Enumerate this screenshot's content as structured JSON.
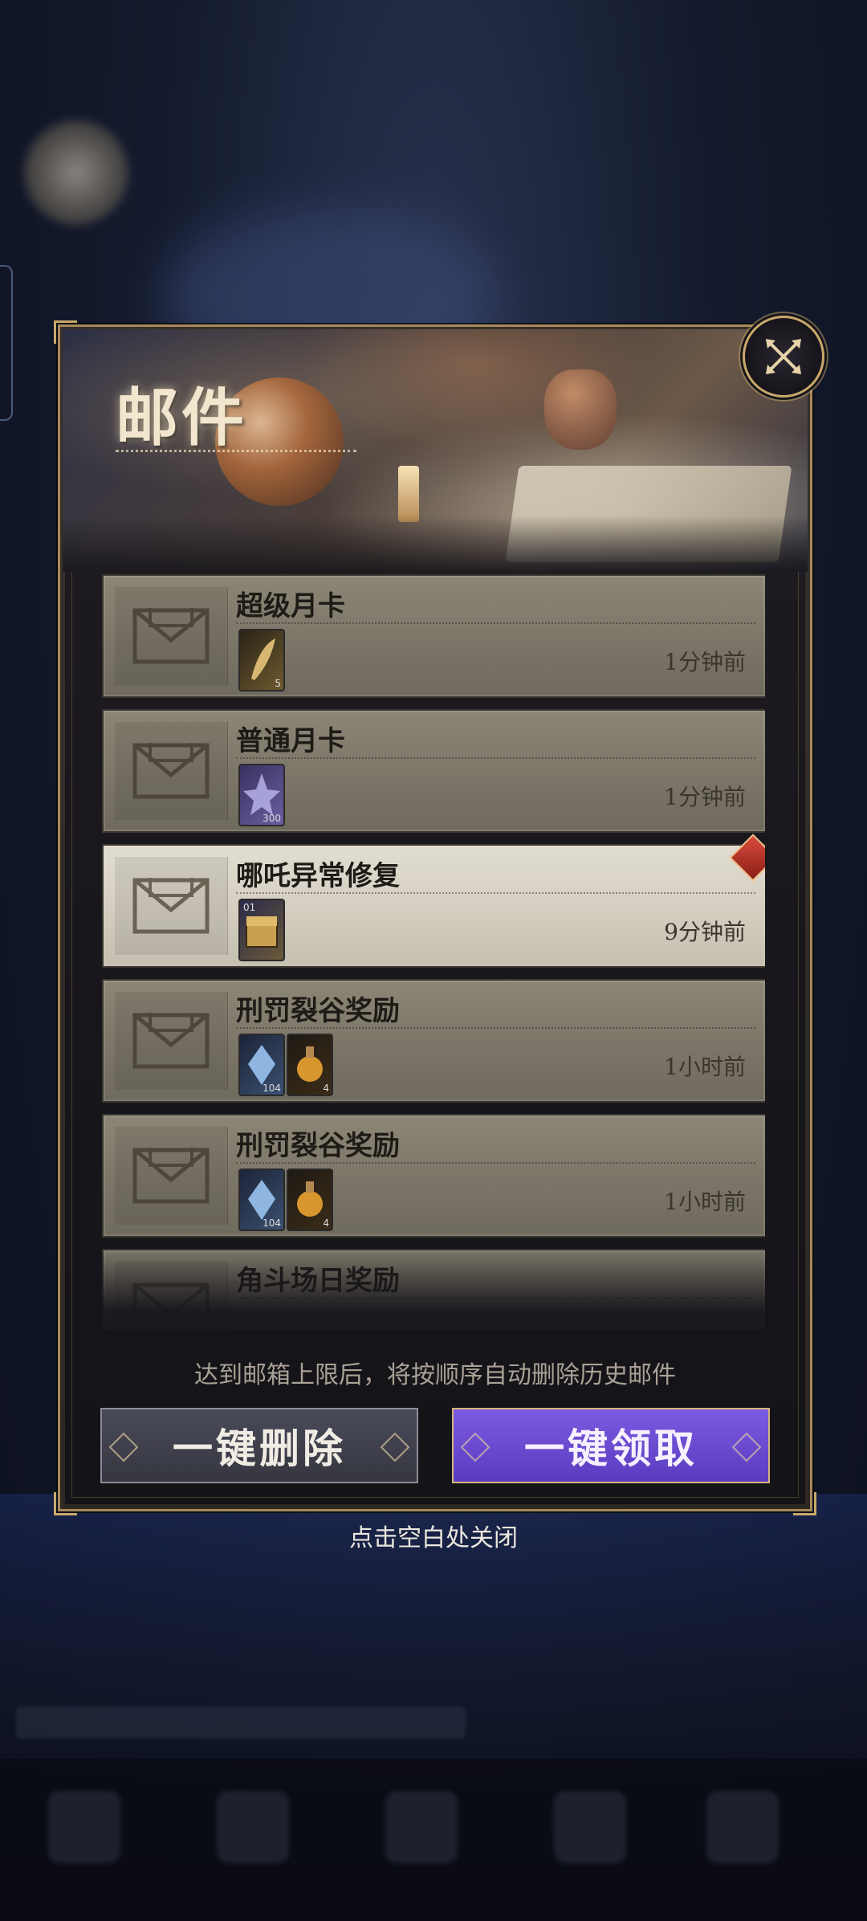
{
  "panel": {
    "title": "邮件",
    "notice": "达到邮箱上限后，将按顺序自动删除历史邮件",
    "buttons": {
      "delete_all": "一键删除",
      "claim_all": "一键领取"
    }
  },
  "mails": [
    {
      "title": "超级月卡",
      "time": "1分钟前",
      "attachments": [
        {
          "icon": "gold-feather-icon",
          "count": "5"
        }
      ]
    },
    {
      "title": "普通月卡",
      "time": "1分钟前",
      "attachments": [
        {
          "icon": "star-crystal-icon",
          "count": "300"
        }
      ]
    },
    {
      "title": "哪吒异常修复",
      "time": "9分钟前",
      "highlight": true,
      "attachments": [
        {
          "icon": "treasure-chest-icon",
          "count": "01"
        }
      ]
    },
    {
      "title": "刑罚裂谷奖励",
      "time": "1小时前",
      "attachments": [
        {
          "icon": "blue-crystal-icon",
          "count": "104"
        },
        {
          "icon": "potion-icon",
          "count": "4"
        }
      ]
    },
    {
      "title": "刑罚裂谷奖励",
      "time": "1小时前",
      "attachments": [
        {
          "icon": "blue-crystal-icon",
          "count": "104"
        },
        {
          "icon": "potion-icon",
          "count": "4"
        }
      ]
    },
    {
      "title": "角斗场日奖励",
      "time": "",
      "attachments": []
    }
  ],
  "close_hint": "点击空白处关闭",
  "colors": {
    "panel_border": "#a88a5a",
    "claim_button": "#6a4bd0",
    "delete_button": "#3d3e4a",
    "mail_card": "#817b6e",
    "mail_card_highlight": "#d8d2c6"
  }
}
